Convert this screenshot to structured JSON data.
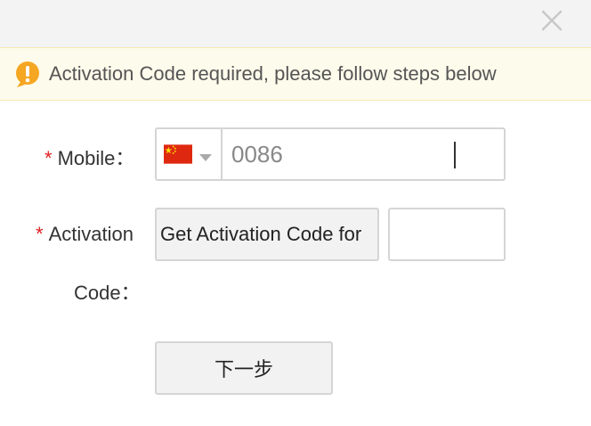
{
  "notice": {
    "icon": "warning-icon",
    "text": "Activation Code required, please follow steps below",
    "color": "#f5a623"
  },
  "form": {
    "required_mark": "*",
    "mobile": {
      "label": "Mobile：",
      "country_flag_icon": "china-flag-icon",
      "value": "0086"
    },
    "activation": {
      "label_line1": "Activation",
      "label_line2": "Code：",
      "get_code_label": "Get Activation Code for",
      "code_value": ""
    },
    "next_label": "下一步"
  },
  "colors": {
    "required": "#e02020",
    "notice_bg": "#fdfbeb",
    "titlebar_bg": "#f3f3f3"
  }
}
